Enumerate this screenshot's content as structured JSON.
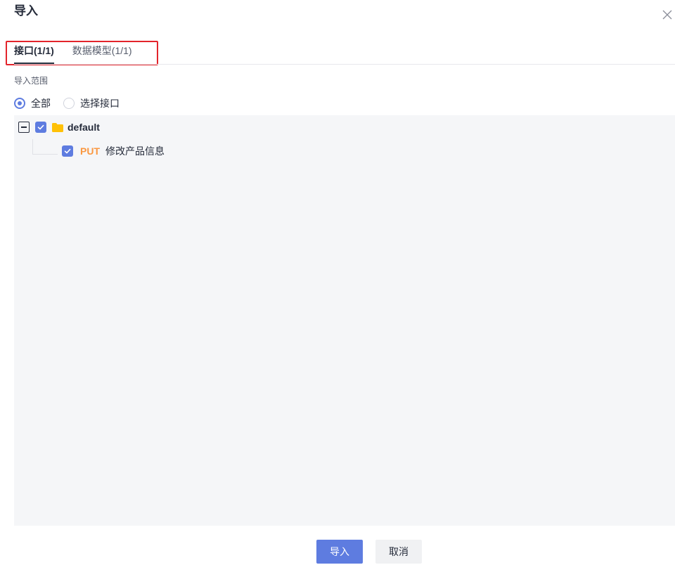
{
  "dialog": {
    "title": "导入",
    "close_icon": "close-icon"
  },
  "tabs": [
    {
      "label": "接口(1/1)",
      "active": true
    },
    {
      "label": "数据模型(1/1)",
      "active": false
    }
  ],
  "scope": {
    "label": "导入范围",
    "options": [
      {
        "label": "全部",
        "checked": true
      },
      {
        "label": "选择接口",
        "checked": false
      }
    ]
  },
  "tree": {
    "root": {
      "label": "default",
      "expanded": true,
      "checked": true,
      "icon": "folder-icon"
    },
    "children": [
      {
        "method": "PUT",
        "name": "修改产品信息",
        "checked": true
      }
    ]
  },
  "footer": {
    "confirm_label": "导入",
    "cancel_label": "取消"
  },
  "colors": {
    "accent": "#5e7ce0",
    "method_put": "#fa9841",
    "highlight_box": "#e3242b",
    "folder": "#ffc107"
  }
}
